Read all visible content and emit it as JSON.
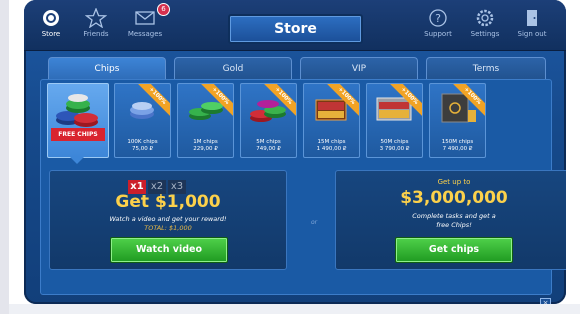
{
  "nav": {
    "store": "Store",
    "friends": "Friends",
    "messages": "Messages",
    "messages_badge": "6",
    "support": "Support",
    "settings": "Settings",
    "signout": "Sign out"
  },
  "title": "Store",
  "tabs": [
    "Chips",
    "Gold",
    "VIP",
    "Terms"
  ],
  "active_tab": "Chips",
  "free_chips_label": "FREE CHIPS",
  "bonus_sash": "+100%",
  "products": [
    {
      "amount": "100K chips",
      "price": "75,00 ₽"
    },
    {
      "amount": "1M chips",
      "price": "229,00 ₽"
    },
    {
      "amount": "5M chips",
      "price": "749,00 ₽"
    },
    {
      "amount": "15M chips",
      "price": "1 490,00 ₽"
    },
    {
      "amount": "50M chips",
      "price": "3 790,00 ₽"
    },
    {
      "amount": "150M chips",
      "price": "7 490,00 ₽"
    }
  ],
  "video_offer": {
    "multipliers": [
      "x1",
      "x2",
      "x3"
    ],
    "selected": "x1",
    "headline": "Get $1,000",
    "subtext": "Watch a video and get your reward!",
    "total": "TOTAL: $1,000",
    "button": "Watch video"
  },
  "or_label": "or",
  "tasks_offer": {
    "heading": "Get up to",
    "headline": "$3,000,000",
    "subtext_line1": "Complete tasks and get a",
    "subtext_line2": "free Chips!",
    "button": "Get chips"
  },
  "close_label": "×",
  "colors": {
    "accent_gold": "#fcd14b",
    "button_green": "#3bbd36",
    "free_red": "#d9242f",
    "sash_orange": "#f1a325",
    "panel_blue": "#1a5aa5"
  }
}
